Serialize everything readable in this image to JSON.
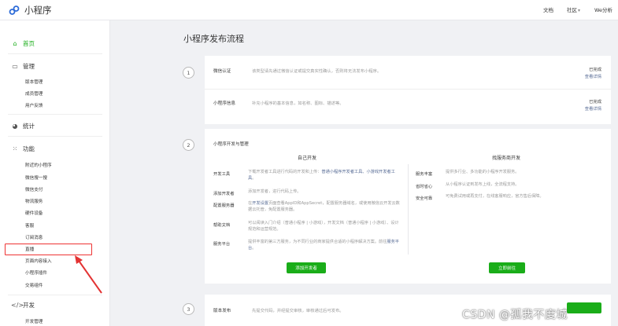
{
  "header": {
    "app_title": "小程序",
    "nav": [
      {
        "label": "文档"
      },
      {
        "label": "社区",
        "chevron": "▾"
      },
      {
        "label": "We分析"
      }
    ]
  },
  "sidebar": {
    "home": {
      "label": "首页",
      "icon": "home-icon"
    },
    "manage": {
      "label": "管理",
      "icon": "monitor-icon",
      "items": [
        "版本管理",
        "成员管理",
        "用户反馈"
      ]
    },
    "stats": {
      "label": "统计",
      "icon": "pie-chart-icon"
    },
    "features": {
      "label": "功能",
      "icon": "grid-icon",
      "items": [
        "附近的小程序",
        "微信搜一搜",
        "微信支付",
        "物流服务",
        "硬件设备",
        "客服",
        "订阅消息",
        "直播",
        "页面内容接入",
        "小程序插件",
        "交易组件"
      ]
    },
    "dev": {
      "label": "开发",
      "icon": "code-icon",
      "items": [
        "开发管理"
      ]
    },
    "highlighted_item": "直播"
  },
  "main": {
    "title": "小程序发布流程",
    "step1": {
      "number": "1",
      "rows": [
        {
          "label": "微信认证",
          "desc": "该类型请先通过微信认证或提交真实性确认，否则将无法发布小程序。",
          "status": "已完成",
          "link": "查看详情"
        },
        {
          "label": "小程序信息",
          "desc": "补充小程序的基本信息，如名称、图标、描述等。",
          "status": "已完成",
          "link": "查看详情"
        }
      ]
    },
    "step2": {
      "number": "2",
      "title": "小程序开发与管理",
      "self_dev": {
        "heading": "自己开发",
        "rows": [
          {
            "label": "开发工具",
            "desc_pre": "下载开发者工具进行代码的开发和上传：",
            "links": "普通小程序开发者工具、小游戏开发者工具",
            "desc_post": "。"
          },
          {
            "label": "添加开发者",
            "desc_pre": "添加开发者，进行代码上传。",
            "links": "",
            "desc_post": ""
          },
          {
            "label": "配置服务器",
            "desc_pre": "在",
            "links": "开发设置",
            "desc_post": "页面查看AppID和AppSecret，配置服务器域名，或使用微信云开发云数据云托管，免配置服务器。"
          },
          {
            "label": "帮助文档",
            "desc_pre": "可以阅读入门介绍（普通小程序 | 小游戏），开发文档（普通小程序 | 小游戏）、设计规范和运营规范。",
            "links": "",
            "desc_post": ""
          },
          {
            "label": "服务平台",
            "desc_pre": "提供丰富的第三方服务，为不同行业的商家提供合适的小程序解决方案。前往",
            "links": "服务平台",
            "desc_post": "。"
          }
        ],
        "button": "添加开发者"
      },
      "provider_dev": {
        "heading": "找服务商开发",
        "rows": [
          {
            "label": "服务丰富",
            "desc": "提供多行业、多功能的小程序开发服务。"
          },
          {
            "label": "省时省心",
            "desc": "从小程序认证到发布上线，全流程支持。"
          },
          {
            "label": "安全可靠",
            "desc": "可免费试用或再支付，在线客服响应，官方售后保障。"
          }
        ],
        "button": "立即前往"
      }
    },
    "step3": {
      "number": "3",
      "label": "版本发布",
      "desc": "先提交代码，并经提交审核，审核通过后可发布。"
    }
  },
  "watermark": "CSDN @孤我不度城",
  "colors": {
    "accent_green": "#1aad19",
    "link_blue": "#576b95",
    "highlight_red": "#e33333"
  }
}
